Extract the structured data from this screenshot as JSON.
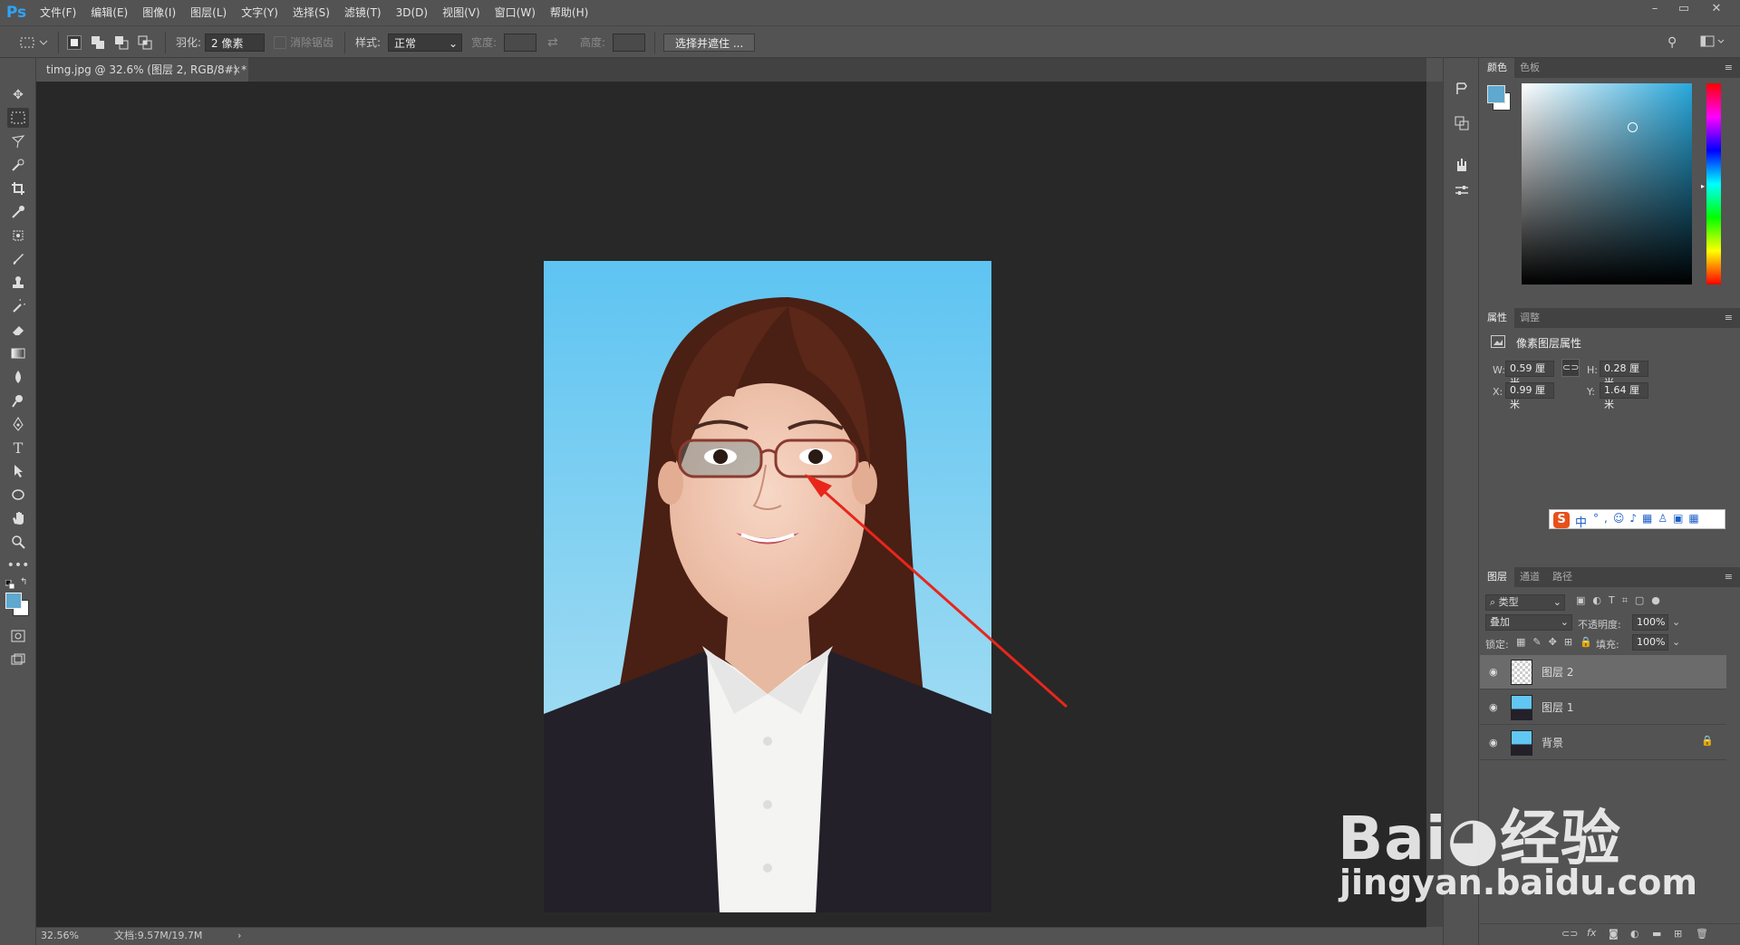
{
  "menubar": {
    "logo": "Ps",
    "items": [
      "文件(F)",
      "编辑(E)",
      "图像(I)",
      "图层(L)",
      "文字(Y)",
      "选择(S)",
      "滤镜(T)",
      "3D(D)",
      "视图(V)",
      "窗口(W)",
      "帮助(H)"
    ],
    "minimize": "–",
    "restore": "▭",
    "close": "✕"
  },
  "options": {
    "feather_label": "羽化:",
    "feather_value": "2 像素",
    "antialias_label": "消除锯齿",
    "style_label": "样式:",
    "style_value": "正常",
    "width_label": "宽度:",
    "height_label": "高度:",
    "select_mask_button": "选择并遮住 ..."
  },
  "document": {
    "tab_title": "timg.jpg @ 32.6% (图层 2, RGB/8#) *",
    "close_glyph": "×"
  },
  "status": {
    "zoom": "32.56%",
    "doc_info": "文档:9.57M/19.7M",
    "arrow": "›"
  },
  "color_panel": {
    "tab_color": "颜色",
    "tab_swatches": "色板",
    "foreground": "#5fa8cf",
    "background": "#ffffff"
  },
  "properties_panel": {
    "tab_properties": "属性",
    "tab_adjust": "调整",
    "title": "像素图层属性",
    "w_label": "W:",
    "w_value": "0.59 厘米",
    "h_label": "H:",
    "h_value": "0.28 厘米",
    "x_label": "X:",
    "x_value": "0.99 厘米",
    "y_label": "Y:",
    "y_value": "1.64 厘米"
  },
  "ime_bar": {
    "text": "中"
  },
  "layers_panel": {
    "tab_layers": "图层",
    "tab_channels": "通道",
    "tab_paths": "路径",
    "filter_kind": "类型",
    "blend_mode": "叠加",
    "opacity_label": "不透明度:",
    "opacity_value": "100%",
    "lock_label": "锁定:",
    "fill_label": "填充:",
    "fill_value": "100%",
    "layers": [
      {
        "name": "图层 2",
        "selected": true
      },
      {
        "name": "图层 1",
        "selected": false
      },
      {
        "name": "背景",
        "selected": false
      }
    ],
    "footer_icons": [
      "link-icon",
      "fx-icon",
      "mask-icon",
      "adjustment-icon",
      "group-icon",
      "new-layer-icon",
      "trash-icon"
    ],
    "fx": "fx"
  },
  "watermark": {
    "brand": "Bai",
    "brand2": "经验",
    "url": "jingyan.baidu.com"
  }
}
